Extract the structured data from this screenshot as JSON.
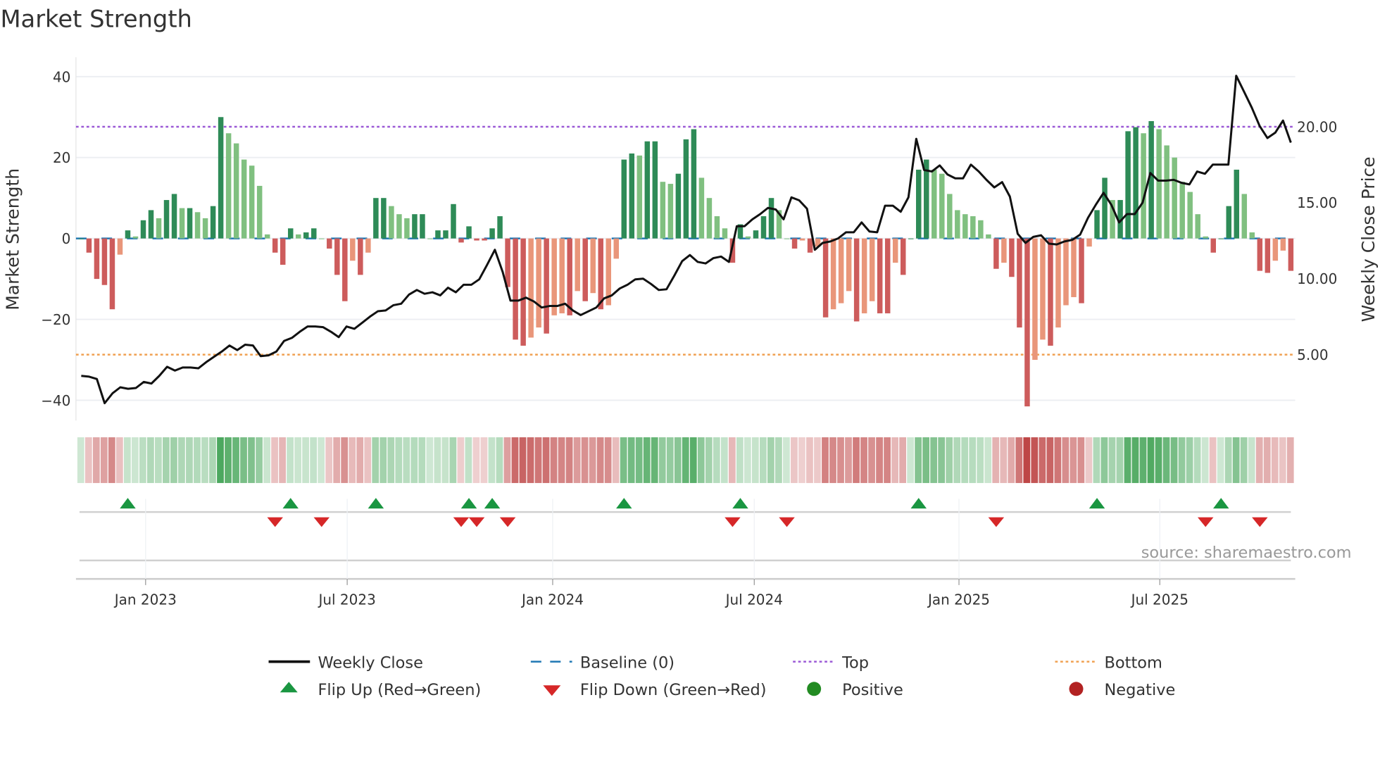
{
  "chart_data": {
    "type": "bar",
    "title": "Market Strength",
    "ylabel": "Market Strength",
    "y2label": "Weekly Close Price",
    "ylim": [
      -45,
      44.8
    ],
    "y2lim": [
      0.66,
      24.57
    ],
    "yticks": [
      {
        "v": 40,
        "label": "40"
      },
      {
        "v": 20,
        "label": "20"
      },
      {
        "v": 0,
        "label": "0"
      },
      {
        "v": -20,
        "label": "−20"
      },
      {
        "v": -40,
        "label": "−40"
      }
    ],
    "y2ticks": [
      {
        "v": 20,
        "label": "20.00"
      },
      {
        "v": 15,
        "label": "15.00"
      },
      {
        "v": 10,
        "label": "10.00"
      },
      {
        "v": 5,
        "label": "5.00"
      }
    ],
    "xticks": [
      {
        "week": 8.3,
        "label": "Jan 2023"
      },
      {
        "week": 34.3,
        "label": "Jul 2023"
      },
      {
        "week": 60.8,
        "label": "Jan 2024"
      },
      {
        "week": 86.8,
        "label": "Jul 2024"
      },
      {
        "week": 113.2,
        "label": "Jan 2025"
      },
      {
        "week": 139.1,
        "label": "Jul 2025"
      }
    ],
    "top_level": 27.6,
    "bottom_level": -28.7,
    "strength": [
      0,
      -3.5,
      -10,
      -11.5,
      -17.5,
      -4,
      2,
      0.5,
      4.5,
      7,
      5,
      9.5,
      11,
      7.5,
      7.5,
      6.5,
      5,
      8,
      30,
      26,
      23.5,
      19.5,
      18,
      13,
      1,
      -3.5,
      -6.5,
      2.5,
      1,
      1.5,
      2.5,
      0,
      -2.5,
      -9,
      -15.5,
      -5.5,
      -9,
      -3.5,
      10,
      10,
      8,
      6,
      5,
      6,
      6,
      0,
      2,
      2,
      8.5,
      -1,
      3,
      -0.5,
      -0.5,
      2.5,
      5.5,
      -12,
      -25,
      -26.5,
      -24.5,
      -22,
      -23.5,
      -19,
      -18.5,
      -19,
      -13,
      -15.5,
      -13.5,
      -17.5,
      -16.5,
      -5,
      19.5,
      21,
      20.5,
      24,
      24,
      14,
      13.5,
      16,
      24.5,
      27,
      15,
      10,
      5.5,
      2.5,
      -6,
      3.5,
      0.5,
      2,
      5.5,
      10,
      7,
      0,
      -2.5,
      -0.5,
      -3.5,
      -2,
      -19.5,
      -17.5,
      -16,
      -13,
      -20.5,
      -18.5,
      -15.5,
      -18.5,
      -18.5,
      -6,
      -9,
      0,
      17,
      19.5,
      17,
      16,
      11,
      7,
      6,
      5.5,
      4.5,
      1,
      -7.5,
      -6,
      -9.5,
      -22,
      -41.5,
      -30,
      -25,
      -26.5,
      -22,
      -16.5,
      -14.5,
      -16,
      -2,
      7,
      15,
      9.5,
      9.5,
      26.5,
      27.5,
      26,
      29,
      27,
      23,
      20,
      14,
      11.5,
      6,
      0.5,
      -3.5,
      0,
      8,
      17,
      11,
      1.5,
      -8,
      -8.5,
      -5.5,
      -3,
      -8
    ],
    "weekly_close": [
      3.6,
      3.55,
      3.4,
      1.8,
      2.45,
      2.85,
      2.75,
      2.8,
      3.2,
      3.1,
      3.6,
      4.2,
      3.95,
      4.15,
      4.15,
      4.1,
      4.5,
      4.85,
      5.2,
      5.6,
      5.3,
      5.65,
      5.6,
      4.9,
      4.95,
      5.2,
      5.9,
      6.1,
      6.5,
      6.85,
      6.85,
      6.8,
      6.5,
      6.15,
      6.85,
      6.7,
      7.1,
      7.5,
      7.85,
      7.9,
      8.25,
      8.35,
      8.95,
      9.25,
      9.0,
      9.1,
      8.9,
      9.4,
      9.1,
      9.6,
      9.6,
      9.95,
      10.9,
      11.9,
      10.45,
      8.55,
      8.55,
      8.75,
      8.5,
      8.1,
      8.2,
      8.2,
      8.35,
      7.9,
      7.6,
      7.85,
      8.1,
      8.7,
      8.9,
      9.35,
      9.6,
      9.95,
      10.0,
      9.65,
      9.25,
      9.3,
      10.2,
      11.15,
      11.55,
      11.1,
      11.0,
      11.35,
      11.45,
      11.1,
      13.45,
      13.45,
      13.9,
      14.25,
      14.65,
      14.55,
      13.9,
      15.35,
      15.15,
      14.6,
      11.9,
      12.35,
      12.45,
      12.65,
      13.05,
      13.05,
      13.7,
      13.1,
      13.05,
      14.8,
      14.8,
      14.4,
      15.35,
      19.2,
      17.15,
      17.05,
      17.45,
      16.85,
      16.6,
      16.6,
      17.5,
      17.05,
      16.5,
      16.0,
      16.35,
      15.4,
      12.95,
      12.35,
      12.75,
      12.85,
      12.3,
      12.25,
      12.45,
      12.55,
      12.9,
      14.0,
      14.85,
      15.65,
      14.85,
      13.7,
      14.25,
      14.25,
      15.0,
      16.95,
      16.45,
      16.45,
      16.5,
      16.3,
      16.2,
      17.05,
      16.9,
      17.5,
      17.5,
      17.5,
      23.35,
      22.3,
      21.25,
      20.05,
      19.25,
      19.6,
      20.4,
      18.95
    ],
    "flip_up_weeks": [
      6,
      27,
      38,
      50,
      53,
      70,
      85,
      108,
      131,
      147
    ],
    "flip_down_weeks": [
      25,
      31,
      49,
      51,
      55,
      84,
      91,
      118,
      145,
      152
    ],
    "colors": {
      "pos_rising": "#2e8b57",
      "pos_falling": "#80c080",
      "neg_falling": "#cd5c5c",
      "neg_rising": "#e9967a",
      "close": "#111111",
      "baseline": "#1f77b4",
      "top": "#9b59d6",
      "bottom": "#f0a050",
      "flip_up": "#1a9641",
      "flip_down": "#d62728",
      "positive": "#228b22",
      "negative": "#b22222"
    },
    "legend": {
      "weekly_close": "Weekly Close",
      "baseline": "Baseline (0)",
      "top": "Top",
      "bottom": "Bottom",
      "flip_up": "Flip Up (Red→Green)",
      "flip_down": "Flip Down (Green→Red)",
      "positive": "Positive",
      "negative": "Negative"
    },
    "source": "source: sharemaestro.com"
  }
}
